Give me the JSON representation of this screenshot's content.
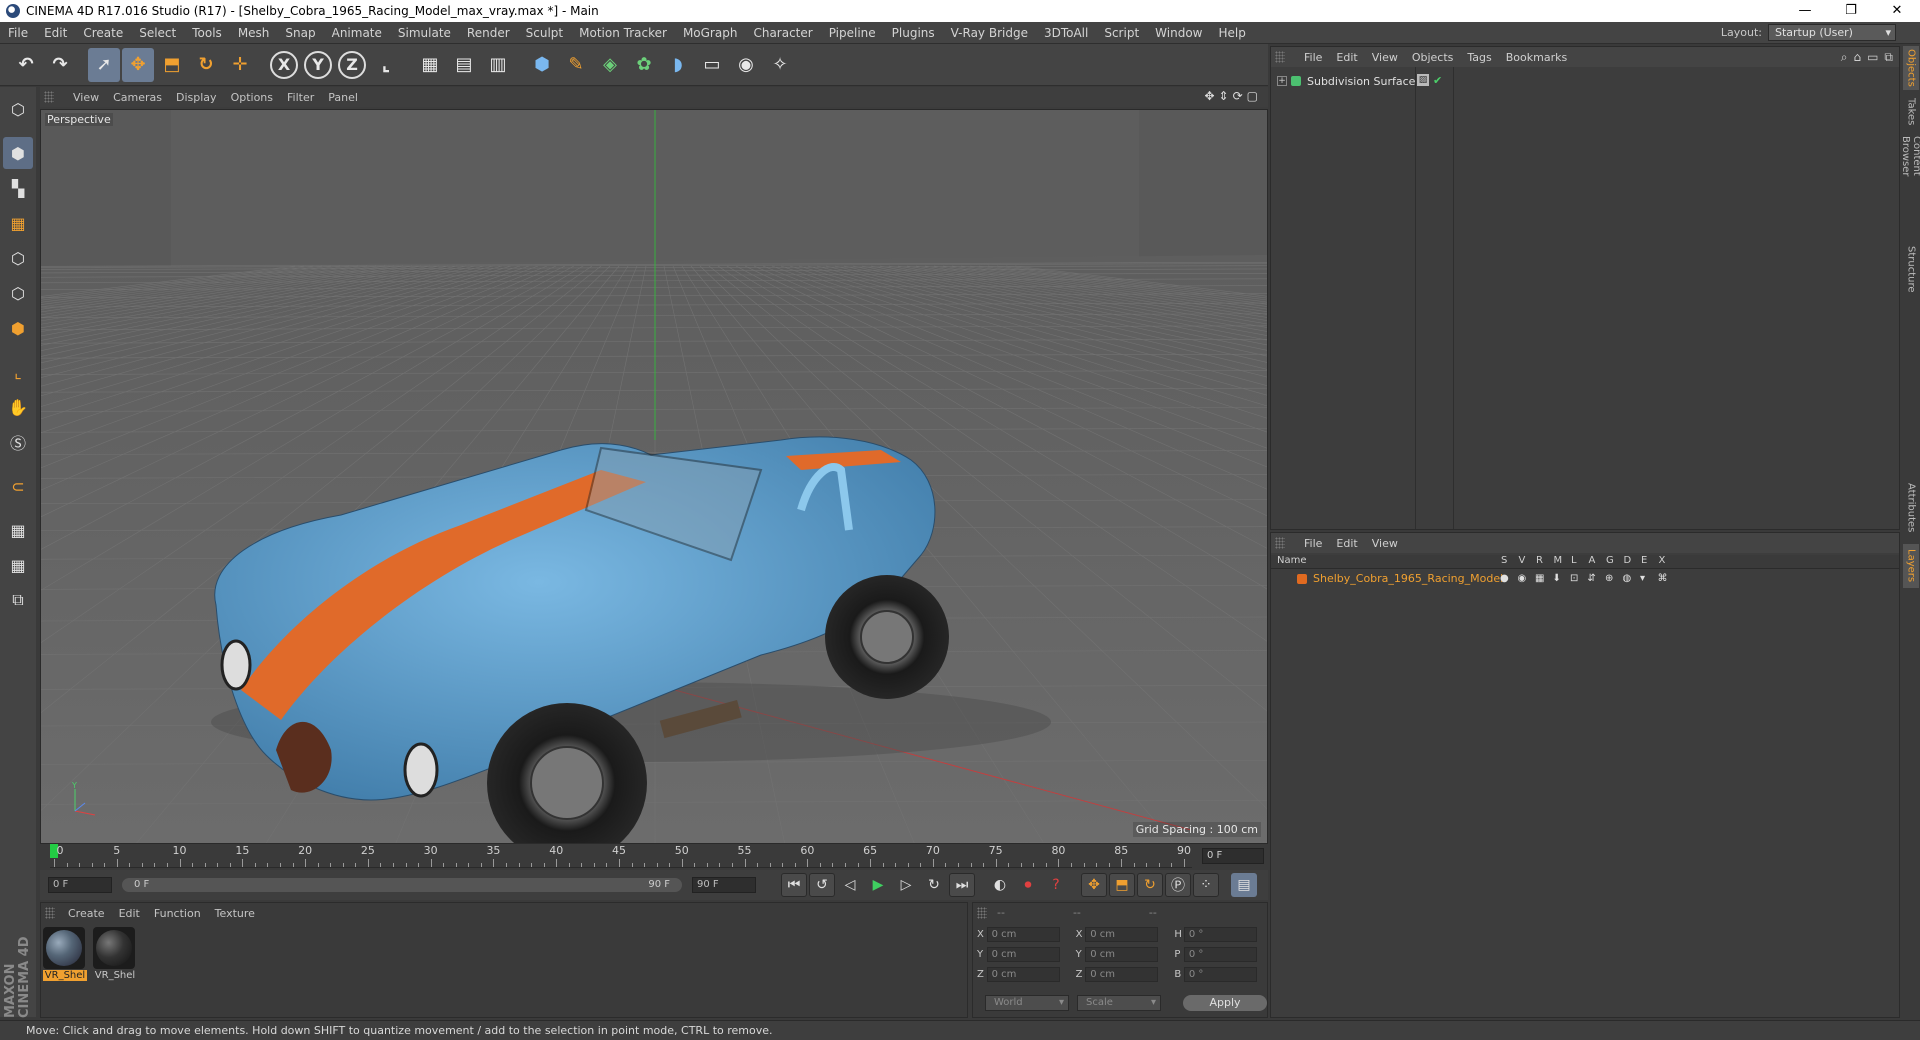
{
  "window": {
    "title": "CINEMA 4D R17.016 Studio (R17) - [Shelby_Cobra_1965_Racing_Model_max_vray.max *] - Main",
    "controls": [
      "—",
      "❐",
      "✕"
    ]
  },
  "menubar": {
    "items": [
      "File",
      "Edit",
      "Create",
      "Select",
      "Tools",
      "Mesh",
      "Snap",
      "Animate",
      "Simulate",
      "Render",
      "Sculpt",
      "Motion Tracker",
      "MoGraph",
      "Character",
      "Pipeline",
      "Plugins",
      "V-Ray Bridge",
      "3DToAll",
      "Script",
      "Window",
      "Help"
    ],
    "layout_label": "Layout:",
    "layout_value": "Startup (User)"
  },
  "toolbar": {
    "tools": [
      {
        "name": "undo-button",
        "glyph": "↶"
      },
      {
        "name": "redo-button",
        "glyph": "↷"
      },
      {
        "name": "select-tool-button",
        "glyph": "➚",
        "active": true
      },
      {
        "name": "move-tool-button",
        "glyph": "✥",
        "active": true,
        "color": "orange"
      },
      {
        "name": "scale-tool-button",
        "glyph": "⬒",
        "color": "orange"
      },
      {
        "name": "rotate-tool-button",
        "glyph": "↻",
        "color": "orange"
      },
      {
        "name": "transform-tool-button",
        "glyph": "✛",
        "color": "orange"
      },
      {
        "name": "x-axis-button",
        "glyph": "X",
        "axis": true
      },
      {
        "name": "y-axis-button",
        "glyph": "Y",
        "axis": true
      },
      {
        "name": "z-axis-button",
        "glyph": "Z",
        "axis": true
      },
      {
        "name": "coordinate-system-button",
        "glyph": "⌞"
      },
      {
        "name": "render-view-button",
        "glyph": "▦"
      },
      {
        "name": "render-picture-viewer-button",
        "glyph": "▤"
      },
      {
        "name": "render-settings-button",
        "glyph": "▥"
      },
      {
        "name": "cube-object-button",
        "glyph": "⬢",
        "color": "blue"
      },
      {
        "name": "pen-spline-button",
        "glyph": "✎",
        "color": "orange"
      },
      {
        "name": "subdivision-surface-button",
        "glyph": "◈",
        "color": "green"
      },
      {
        "name": "cloner-button",
        "glyph": "✿",
        "color": "green"
      },
      {
        "name": "deformer-button",
        "glyph": "◗",
        "color": "blue"
      },
      {
        "name": "floor-button",
        "glyph": "▭"
      },
      {
        "name": "camera-button",
        "glyph": "◉"
      },
      {
        "name": "light-button",
        "glyph": "✧"
      }
    ]
  },
  "left_tools": [
    {
      "name": "make-editable-icon",
      "glyph": "⬡"
    },
    {
      "name": "model-mode-icon",
      "glyph": "⬢",
      "active": true
    },
    {
      "name": "texture-mode-icon",
      "glyph": "▚"
    },
    {
      "name": "workplane-mode-icon",
      "glyph": "▦",
      "color": "orange"
    },
    {
      "name": "points-mode-icon",
      "glyph": "⬡"
    },
    {
      "name": "edges-mode-icon",
      "glyph": "⬡"
    },
    {
      "name": "polygons-mode-icon",
      "glyph": "⬢",
      "color": "orange"
    },
    {
      "name": "axis-mode-icon",
      "glyph": "⌞",
      "color": "orange"
    },
    {
      "name": "tweak-mode-icon",
      "glyph": "✋"
    },
    {
      "name": "solo-mode-icon",
      "glyph": "Ⓢ"
    },
    {
      "name": "magnet-icon",
      "glyph": "⊂",
      "color": "orange"
    },
    {
      "name": "snap-lock-icon",
      "glyph": "▦"
    },
    {
      "name": "snap-settings-icon",
      "glyph": "▦"
    },
    {
      "name": "python-icon",
      "glyph": "⧉"
    }
  ],
  "viewport": {
    "menu": [
      "View",
      "Cameras",
      "Display",
      "Options",
      "Filter",
      "Panel"
    ],
    "label": "Perspective",
    "grid_spacing": "Grid Spacing : 100 cm"
  },
  "timeline": {
    "labels": [
      "0",
      "5",
      "10",
      "15",
      "20",
      "25",
      "30",
      "35",
      "40",
      "45",
      "50",
      "55",
      "60",
      "65",
      "70",
      "75",
      "80",
      "85",
      "90"
    ],
    "current_frame": "0 F",
    "max_frames": 90
  },
  "transport": {
    "start_field": "0 F",
    "range_start": "0 F",
    "range_end": "90 F",
    "end_field": "90 F",
    "controls": [
      {
        "name": "go-to-start-button",
        "glyph": "⏮",
        "box": true
      },
      {
        "name": "previous-key-button",
        "glyph": "↺",
        "box": true
      },
      {
        "name": "previous-frame-button",
        "glyph": "◁"
      },
      {
        "name": "play-button",
        "glyph": "▶",
        "cls": "play"
      },
      {
        "name": "next-frame-button",
        "glyph": "▷"
      },
      {
        "name": "next-key-button",
        "glyph": "↻"
      },
      {
        "name": "go-to-end-button",
        "glyph": "⏭",
        "box": true
      },
      {
        "name": "record-keys-button",
        "glyph": "◐"
      },
      {
        "name": "autokey-button",
        "glyph": "⏺",
        "cls": "red"
      },
      {
        "name": "keyframe-selection-button",
        "glyph": "?",
        "cls": "red"
      },
      {
        "name": "position-key-button",
        "glyph": "✥",
        "cls": "orange",
        "box": true
      },
      {
        "name": "scale-key-button",
        "glyph": "⬒",
        "cls": "orange",
        "box": true
      },
      {
        "name": "rotation-key-button",
        "glyph": "↻",
        "cls": "orange",
        "box": true
      },
      {
        "name": "parameter-key-button",
        "glyph": "Ⓟ",
        "box": true
      },
      {
        "name": "pla-key-button",
        "glyph": "⁘",
        "box": true
      },
      {
        "name": "timeline-button",
        "glyph": "▤",
        "cls": "blueb"
      }
    ]
  },
  "material_manager": {
    "menu": [
      "Create",
      "Edit",
      "Function",
      "Texture"
    ],
    "materials": [
      {
        "name": "VR_Shel",
        "selected": true,
        "sphere": "radial-gradient(circle at 35% 35%, #9ab 0%, #567 40%, #223 100%)"
      },
      {
        "name": "VR_Shel",
        "selected": false,
        "sphere": "radial-gradient(circle at 35% 35%, #777 0%, #333 45%, #111 100%)"
      }
    ],
    "brand": "MAXON CINEMA 4D"
  },
  "coordinates": {
    "header": [
      "--",
      "--",
      "--"
    ],
    "rows": [
      {
        "a1": "X",
        "v1": "0 cm",
        "a2": "X",
        "v2": "0 cm",
        "a3": "H",
        "v3": "0 °"
      },
      {
        "a1": "Y",
        "v1": "0 cm",
        "a2": "Y",
        "v2": "0 cm",
        "a3": "P",
        "v3": "0 °"
      },
      {
        "a1": "Z",
        "v1": "0 cm",
        "a2": "Z",
        "v2": "0 cm",
        "a3": "B",
        "v3": "0 °"
      }
    ],
    "mode1": "World",
    "mode2": "Scale",
    "apply": "Apply"
  },
  "status": "Move: Click and drag to move elements. Hold down SHIFT to quantize movement / add to the selection in point mode, CTRL to remove.",
  "object_manager": {
    "menu": [
      "File",
      "Edit",
      "View",
      "Objects",
      "Tags",
      "Bookmarks"
    ],
    "object": "Subdivision Surface"
  },
  "layer_manager": {
    "menu": [
      "File",
      "Edit",
      "View"
    ],
    "columns": [
      "Name",
      "S",
      "V",
      "R",
      "M",
      "L",
      "A",
      "G",
      "D",
      "E",
      "X"
    ],
    "layer": "Shelby_Cobra_1965_Racing_Model"
  },
  "right_tabs": [
    "Objects",
    "Takes",
    "Content Browser",
    "Structure",
    "Attributes",
    "Layers"
  ],
  "colors": {
    "accent": "#f0a030",
    "car_body": "#5fa0cf",
    "car_stripe": "#e06a2a",
    "playhead": "#22cc44"
  }
}
